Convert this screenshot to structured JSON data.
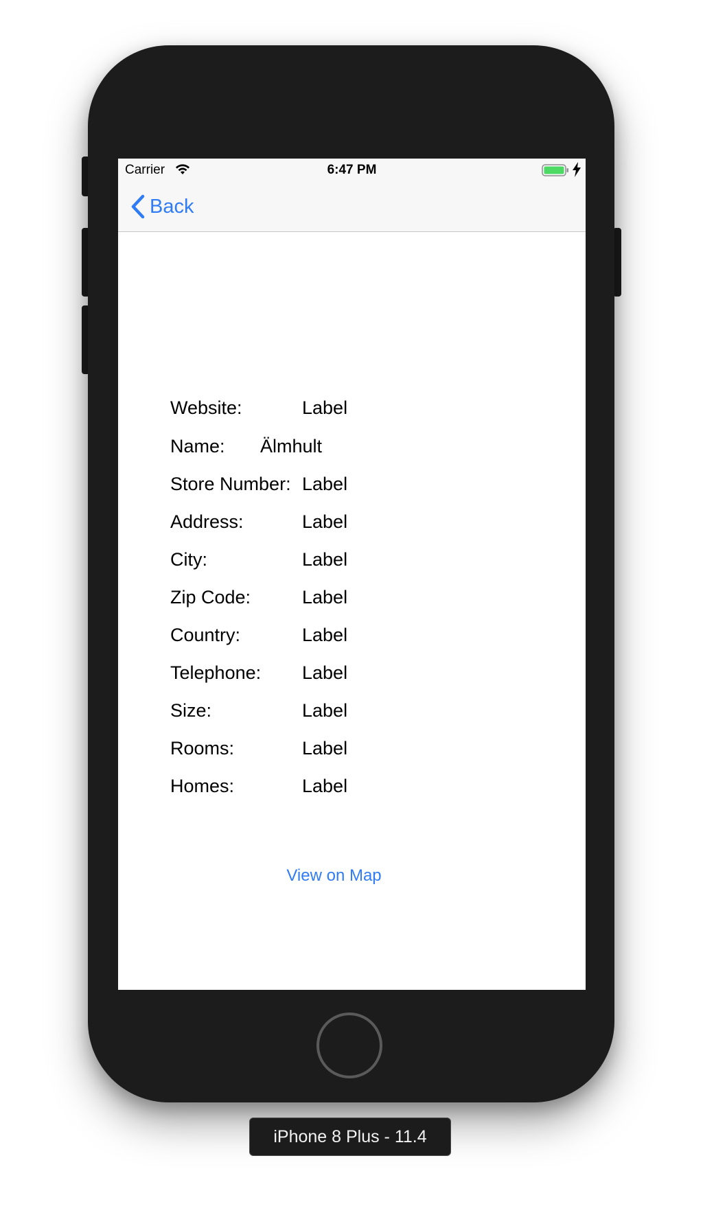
{
  "status_bar": {
    "carrier": "Carrier",
    "time": "6:47 PM",
    "wifi_icon": "wifi-icon",
    "battery_icon": "battery-charging-icon",
    "battery_color": "#4cd964"
  },
  "nav_bar": {
    "back_label": "Back",
    "back_icon": "chevron-left-icon"
  },
  "details": [
    {
      "label": "Website:",
      "value": "Label"
    },
    {
      "label": "Name:",
      "value": "Älmhult"
    },
    {
      "label": "Store Number:",
      "value": "Label"
    },
    {
      "label": "Address:",
      "value": "Label"
    },
    {
      "label": "City:",
      "value": "Label"
    },
    {
      "label": "Zip Code:",
      "value": "Label"
    },
    {
      "label": "Country:",
      "value": "Label"
    },
    {
      "label": "Telephone:",
      "value": "Label"
    },
    {
      "label": "Size:",
      "value": "Label"
    },
    {
      "label": "Rooms:",
      "value": "Label"
    },
    {
      "label": "Homes:",
      "value": "Label"
    }
  ],
  "map_button_label": "View on Map",
  "device_caption": "iPhone 8 Plus - 11.4",
  "colors": {
    "accent": "#2f7cf6",
    "device_body": "#1c1c1c",
    "bar_background": "#f7f7f7"
  }
}
